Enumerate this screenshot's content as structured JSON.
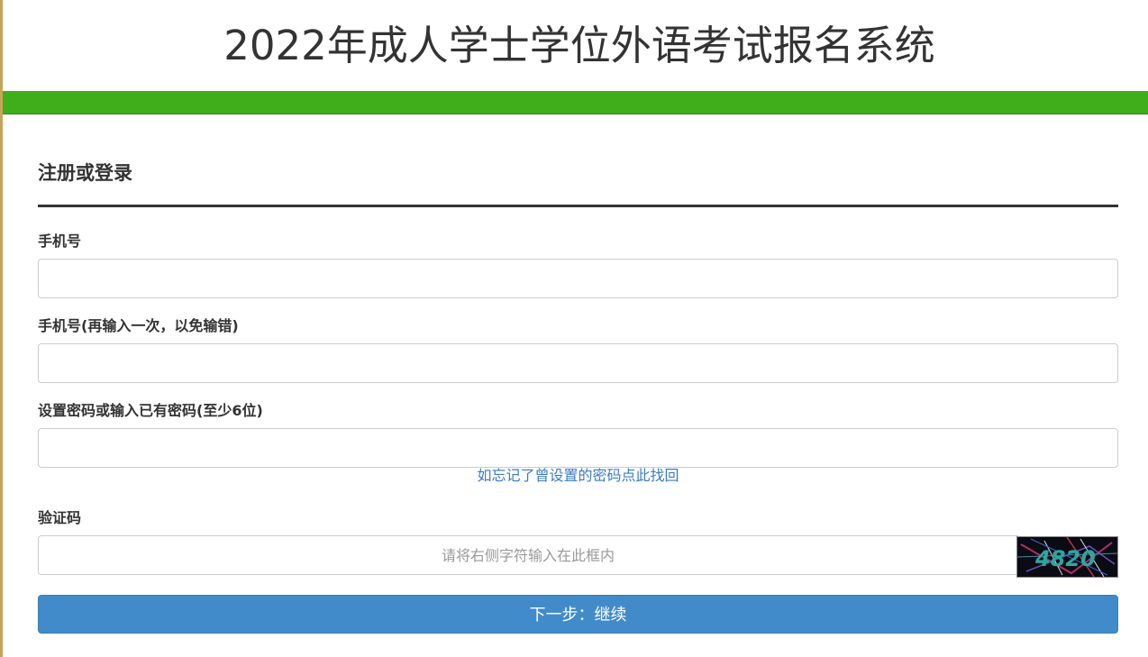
{
  "header": {
    "title": "2022年成人学士学位外语考试报名系统"
  },
  "form": {
    "section_title": "注册或登录",
    "phone_label": "手机号",
    "phone_value": "",
    "phone_confirm_label": "手机号(再输入一次，以免输错)",
    "phone_confirm_value": "",
    "password_label": "设置密码或输入已有密码(至少6位)",
    "password_value": "",
    "forgot_link": "如忘记了曾设置的密码点此找回",
    "captcha_label": "验证码",
    "captcha_placeholder": "请将右侧字符输入在此框内",
    "captcha_value": "",
    "captcha_text": "4820",
    "submit_label": "下一步：继续"
  },
  "colors": {
    "accent_bar": "#3fae1a",
    "button": "#428bca",
    "link": "#3a7bc8",
    "left_edge": "#c8a45a"
  }
}
